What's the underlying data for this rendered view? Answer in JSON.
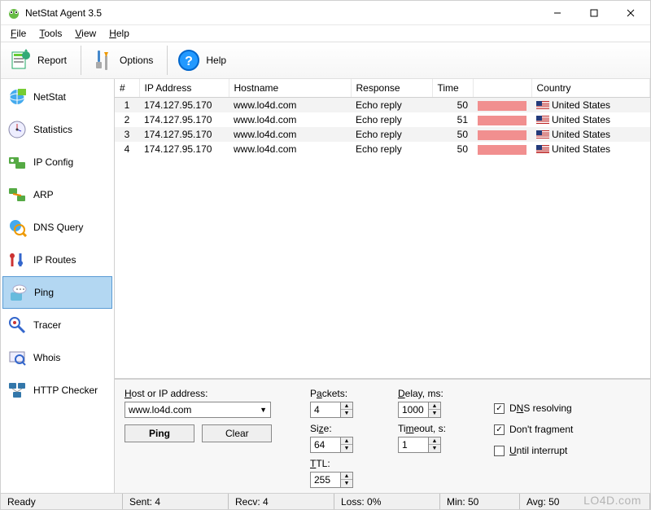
{
  "app": {
    "title": "NetStat Agent 3.5"
  },
  "menu": {
    "file": "File",
    "tools": "Tools",
    "view": "View",
    "help": "Help"
  },
  "toolbar": {
    "report": "Report",
    "options": "Options",
    "help": "Help"
  },
  "sidebar": {
    "items": [
      {
        "id": "netstat",
        "label": "NetStat"
      },
      {
        "id": "statistics",
        "label": "Statistics"
      },
      {
        "id": "ipconfig",
        "label": "IP Config"
      },
      {
        "id": "arp",
        "label": "ARP"
      },
      {
        "id": "dnsquery",
        "label": "DNS Query"
      },
      {
        "id": "iproutes",
        "label": "IP Routes"
      },
      {
        "id": "ping",
        "label": "Ping"
      },
      {
        "id": "tracer",
        "label": "Tracer"
      },
      {
        "id": "whois",
        "label": "Whois"
      },
      {
        "id": "httpchecker",
        "label": "HTTP Checker"
      }
    ],
    "active": "ping"
  },
  "table": {
    "headers": [
      "#",
      "IP Address",
      "Hostname",
      "Response",
      "Time",
      "",
      "Country"
    ],
    "rows": [
      {
        "n": "1",
        "ip": "174.127.95.170",
        "host": "www.lo4d.com",
        "resp": "Echo reply",
        "time": "50",
        "country": "United States"
      },
      {
        "n": "2",
        "ip": "174.127.95.170",
        "host": "www.lo4d.com",
        "resp": "Echo reply",
        "time": "51",
        "country": "United States"
      },
      {
        "n": "3",
        "ip": "174.127.95.170",
        "host": "www.lo4d.com",
        "resp": "Echo reply",
        "time": "50",
        "country": "United States"
      },
      {
        "n": "4",
        "ip": "174.127.95.170",
        "host": "www.lo4d.com",
        "resp": "Echo reply",
        "time": "50",
        "country": "United States"
      }
    ]
  },
  "panel": {
    "host_label": "Host or IP address:",
    "host_value": "www.lo4d.com",
    "ping_btn": "Ping",
    "clear_btn": "Clear",
    "packets_label": "Packets:",
    "packets_value": "4",
    "size_label": "Size:",
    "size_value": "64",
    "ttl_label": "TTL:",
    "ttl_value": "255",
    "delay_label": "Delay, ms:",
    "delay_value": "1000",
    "timeout_label": "Timeout, s:",
    "timeout_value": "1",
    "dns_resolving": "DNS resolving",
    "dont_fragment": "Don't fragment",
    "until_interrupt": "Until interrupt",
    "dns_checked": true,
    "frag_checked": true,
    "until_checked": false
  },
  "status": {
    "ready": "Ready",
    "sent": "Sent: 4",
    "recv": "Recv: 4",
    "loss": "Loss: 0%",
    "min": "Min: 50",
    "avg": "Avg: 50"
  },
  "watermark": "LO4D.com"
}
